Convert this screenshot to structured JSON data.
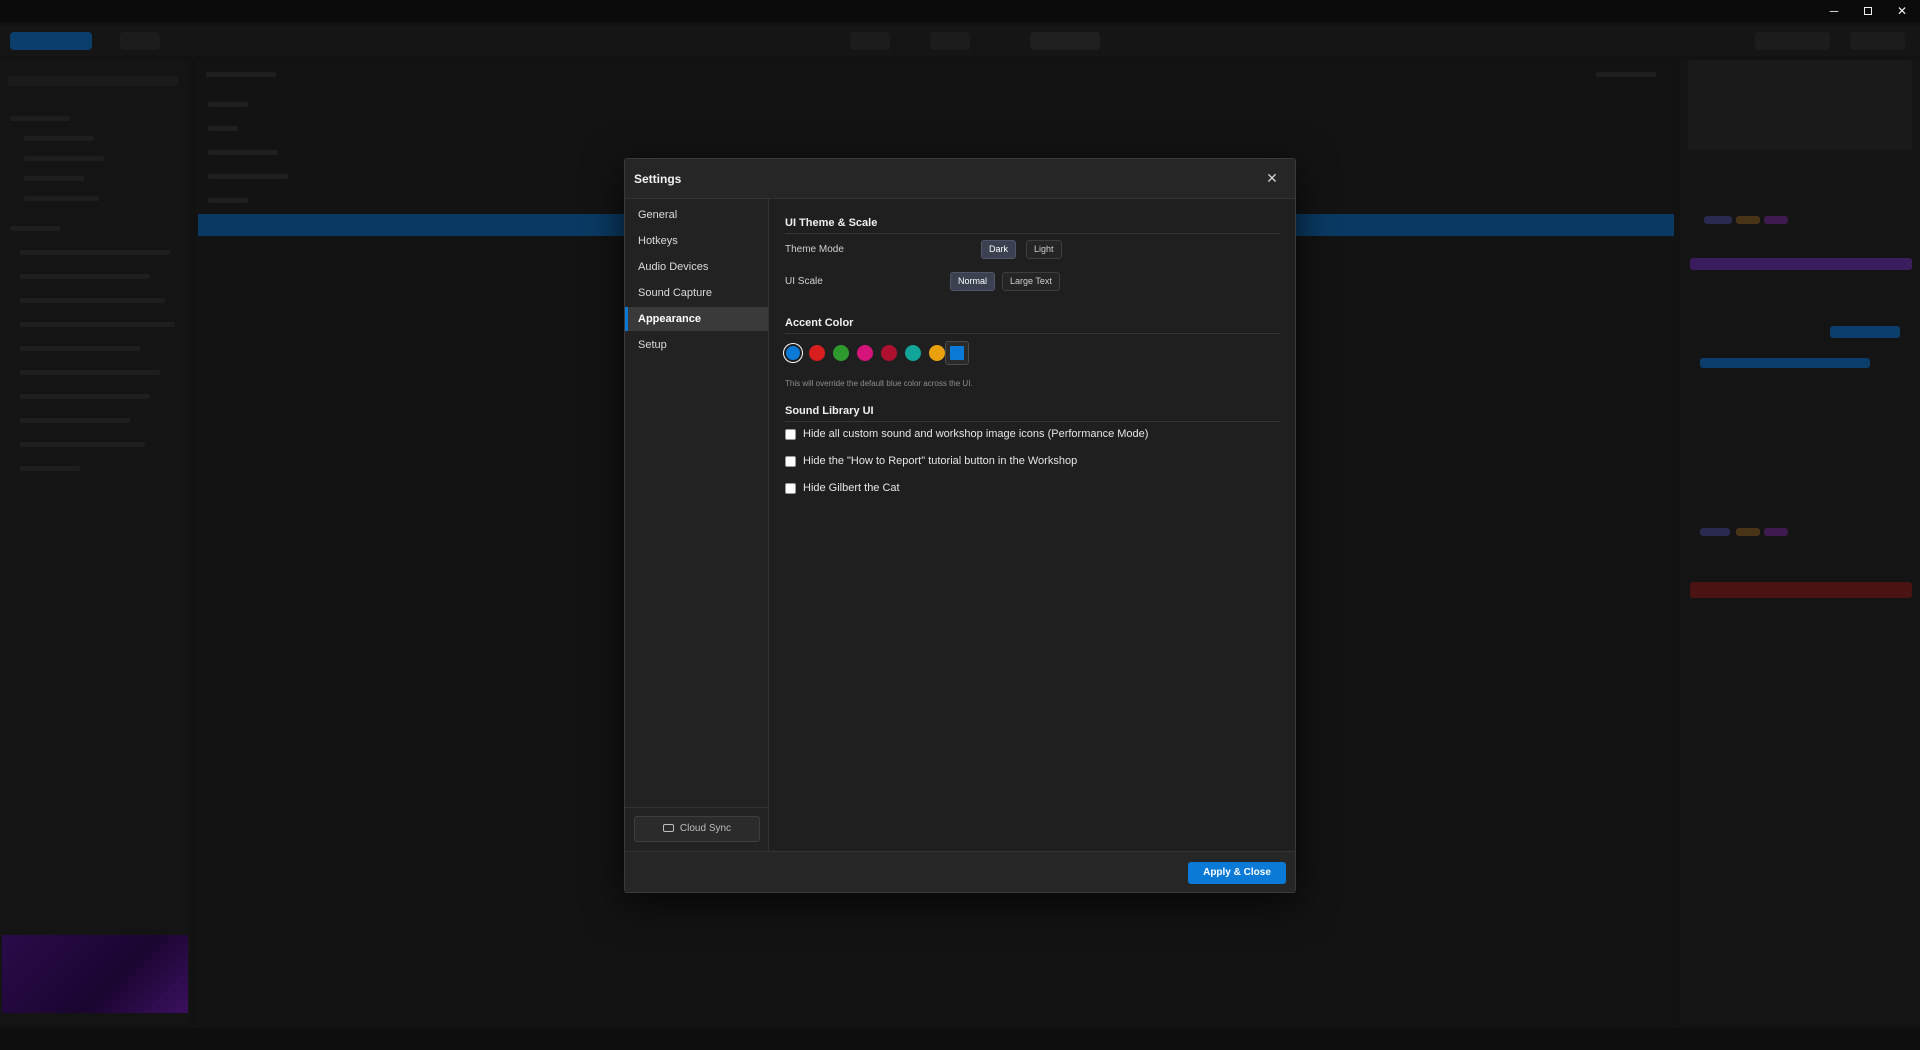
{
  "window": {
    "minimize_glyph": "─",
    "close_glyph": "✕"
  },
  "dialog": {
    "title": "Settings",
    "close_glyph": "✕"
  },
  "nav": {
    "items": [
      {
        "label": "General",
        "active": false
      },
      {
        "label": "Hotkeys",
        "active": false
      },
      {
        "label": "Audio Devices",
        "active": false
      },
      {
        "label": "Sound Capture",
        "active": false
      },
      {
        "label": "Appearance",
        "active": true
      },
      {
        "label": "Setup",
        "active": false
      }
    ],
    "cloud_sync_label": "Cloud Sync",
    "cloud_sync_icon": "cloud-icon"
  },
  "appearance": {
    "theme_section_title": "UI Theme & Scale",
    "theme_mode_label": "Theme Mode",
    "theme_options": [
      "Dark",
      "Light"
    ],
    "theme_selected": "Dark",
    "ui_scale_label": "UI Scale",
    "scale_options": [
      "Normal",
      "Large Text"
    ],
    "scale_selected": "Normal",
    "accent_section_title": "Accent Color",
    "accent_colors": [
      "#0a7ad6",
      "#d81e1e",
      "#2e9a2e",
      "#d4147a",
      "#b01030",
      "#12a69a",
      "#e8a00e",
      "#7a12e0"
    ],
    "accent_selected_index": 0,
    "custom_color": "#0a7ad6",
    "accent_hint": "This will override the default blue color across the UI.",
    "library_section_title": "Sound Library UI",
    "options": [
      {
        "label": "Hide all custom sound and workshop image icons (Performance Mode)",
        "checked": false
      },
      {
        "label": "Hide the \"How to Report\" tutorial button in the Workshop",
        "checked": false
      },
      {
        "label": "Hide Gilbert the Cat",
        "checked": false
      }
    ]
  },
  "footer": {
    "apply_label": "Apply & Close"
  },
  "colors": {
    "accent": "#0a7ad6",
    "dialog_bg": "#1f1f1f",
    "page_bg": "#0d0d0d"
  }
}
